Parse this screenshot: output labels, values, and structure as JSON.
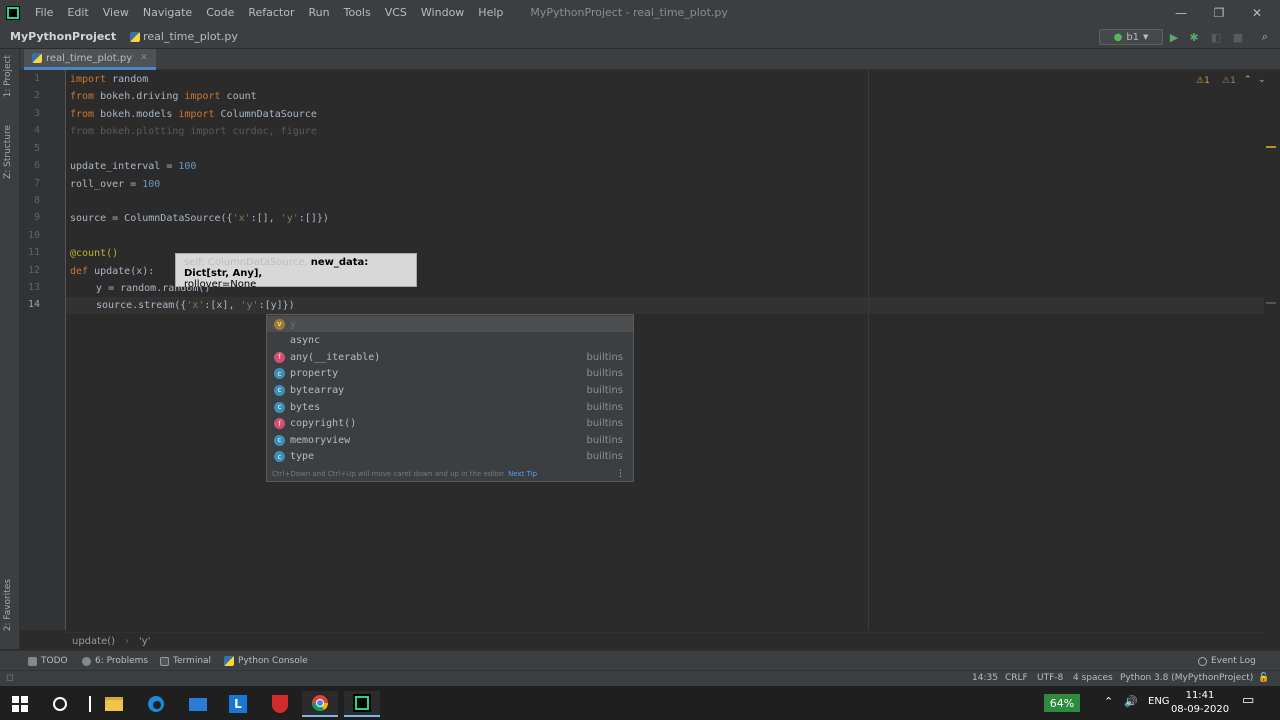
{
  "titlebar": {
    "menu": [
      "File",
      "Edit",
      "View",
      "Navigate",
      "Code",
      "Refactor",
      "Run",
      "Tools",
      "VCS",
      "Window",
      "Help"
    ],
    "window_title": "MyPythonProject - real_time_plot.py",
    "minimize": "—",
    "maximize": "❐",
    "close": "✕"
  },
  "navbar": {
    "project": "MyPythonProject",
    "file": "real_time_plot.py",
    "run_config": "b1"
  },
  "left_strip": {
    "project_label": "1: Project",
    "structure_label": "Z: Structure",
    "favorites_label": "2: Favorites"
  },
  "editor": {
    "tab_label": "real_time_plot.py",
    "tab_close": "✕",
    "line_numbers": [
      "1",
      "2",
      "3",
      "4",
      "5",
      "6",
      "7",
      "8",
      "9",
      "10",
      "11",
      "12",
      "13",
      "14"
    ],
    "inspection_counts": {
      "warnings": "1",
      "weak": "1"
    }
  },
  "code": {
    "l1_kw": "import",
    "l1_rest": " random",
    "l2_kw1": "from",
    "l2_mid": " bokeh.driving ",
    "l2_kw2": "import",
    "l2_rest": " count",
    "l3_kw1": "from",
    "l3_mid": " bokeh.models ",
    "l3_kw2": "import",
    "l3_rest": " ColumnDataSource",
    "l4": "from bokeh.plotting import curdoc, figure",
    "l6_a": "update_interval = ",
    "l6_num": "100",
    "l7_a": "roll_over = ",
    "l7_num": "100",
    "l9_a": "source = ColumnDataSource({",
    "l9_s1": "'x'",
    "l9_b": ":[], ",
    "l9_s2": "'y'",
    "l9_c": ":[]})",
    "l11": "@count()",
    "l12_kw": "def",
    "l12_rest": " update(x):",
    "l13": "y = random.random()",
    "l14_a": "source.stream({",
    "l14_s1": "'x'",
    "l14_b": ":[x], ",
    "l14_s2": "'y'",
    "l14_c": ":[y]})"
  },
  "param_hint": {
    "muted": "self: ColumnDataSource, ",
    "current": "new_data: Dict[str, Any],",
    "rest": "rollover=None"
  },
  "completion": {
    "items": [
      {
        "kind": "v",
        "label": "y",
        "type": ""
      },
      {
        "kind": "",
        "label": "async",
        "type": ""
      },
      {
        "kind": "f",
        "label": "any(__iterable)",
        "type": "builtins"
      },
      {
        "kind": "c",
        "label": "property",
        "type": "builtins"
      },
      {
        "kind": "c",
        "label": "bytearray",
        "type": "builtins"
      },
      {
        "kind": "c",
        "label": "bytes",
        "type": "builtins"
      },
      {
        "kind": "f",
        "label": "copyright()",
        "type": "builtins"
      },
      {
        "kind": "c",
        "label": "memoryview",
        "type": "builtins"
      },
      {
        "kind": "c",
        "label": "type",
        "type": "builtins"
      }
    ],
    "footer": "Ctrl+Down and Ctrl+Up will move caret down and up in the editor",
    "tip": "Next Tip",
    "more": "⋮"
  },
  "breadcrumb": {
    "func": "update()",
    "var": "'y'"
  },
  "bottom_tools": {
    "todo": "TODO",
    "problems": "6: Problems",
    "terminal": "Terminal",
    "console": "Python Console",
    "event_log": "Event Log"
  },
  "statusbar": {
    "position": "14:35",
    "line_sep": "CRLF",
    "encoding": "UTF-8",
    "indent": "4 spaces",
    "interpreter": "Python 3.8 (MyPythonProject)"
  },
  "taskbar": {
    "battery": "64%",
    "language": "ENG",
    "time": "11:41",
    "date": "08-09-2020"
  },
  "colors": {
    "accent": "#4a88c7",
    "keyword": "#cc7832",
    "number": "#6897bb",
    "string": "#6a8759"
  }
}
